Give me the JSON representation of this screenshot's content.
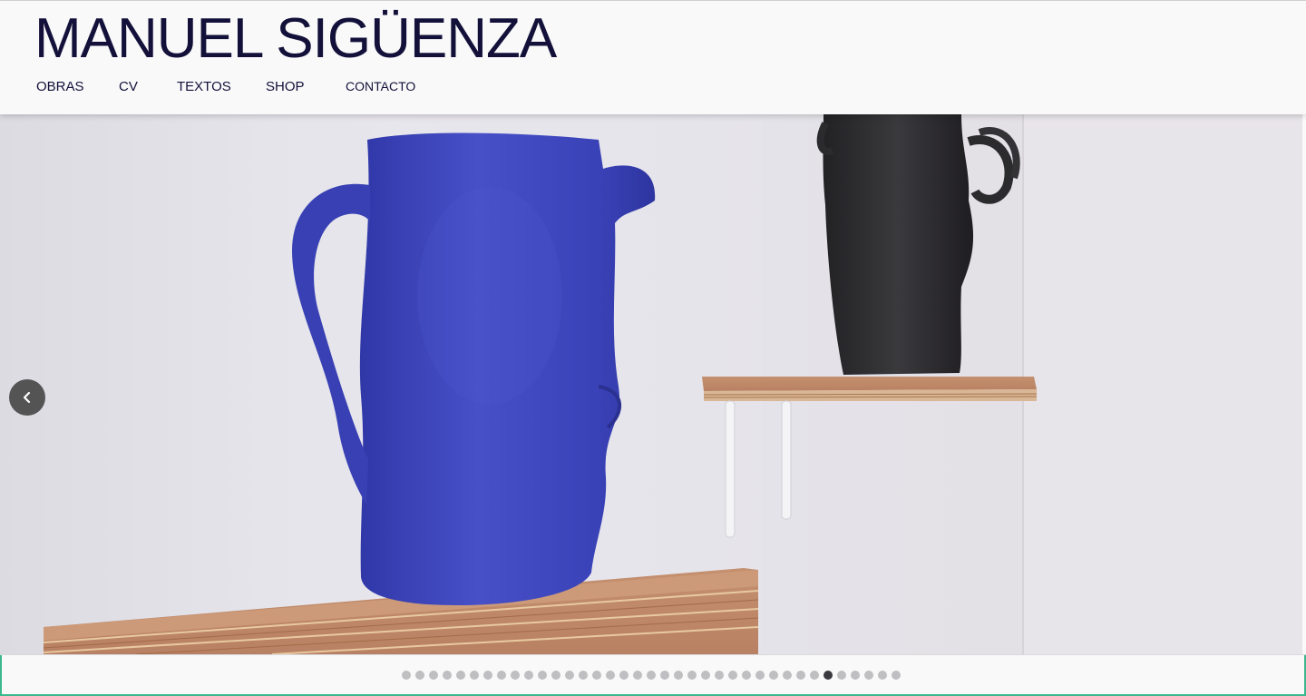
{
  "site": {
    "title": "MANUEL SIGÜENZA"
  },
  "nav": {
    "items": [
      {
        "label": "OBRAS"
      },
      {
        "label": "CV"
      },
      {
        "label": "TEXTOS"
      },
      {
        "label": "SHOP"
      },
      {
        "label": "CONTACTO"
      }
    ]
  },
  "slider": {
    "image_description_icon": "ceramic-head-vases-photo",
    "prev_icon": "chevron-left-icon",
    "total_slides": 37,
    "active_slide": 32
  },
  "colors": {
    "title": "#13113a",
    "vase_blue": "#3d45c0",
    "vase_black": "#2b2a2c",
    "dot_inactive": "#bfbfc2",
    "dot_active": "#3a3a3e",
    "accent_green": "#3bb88c"
  }
}
